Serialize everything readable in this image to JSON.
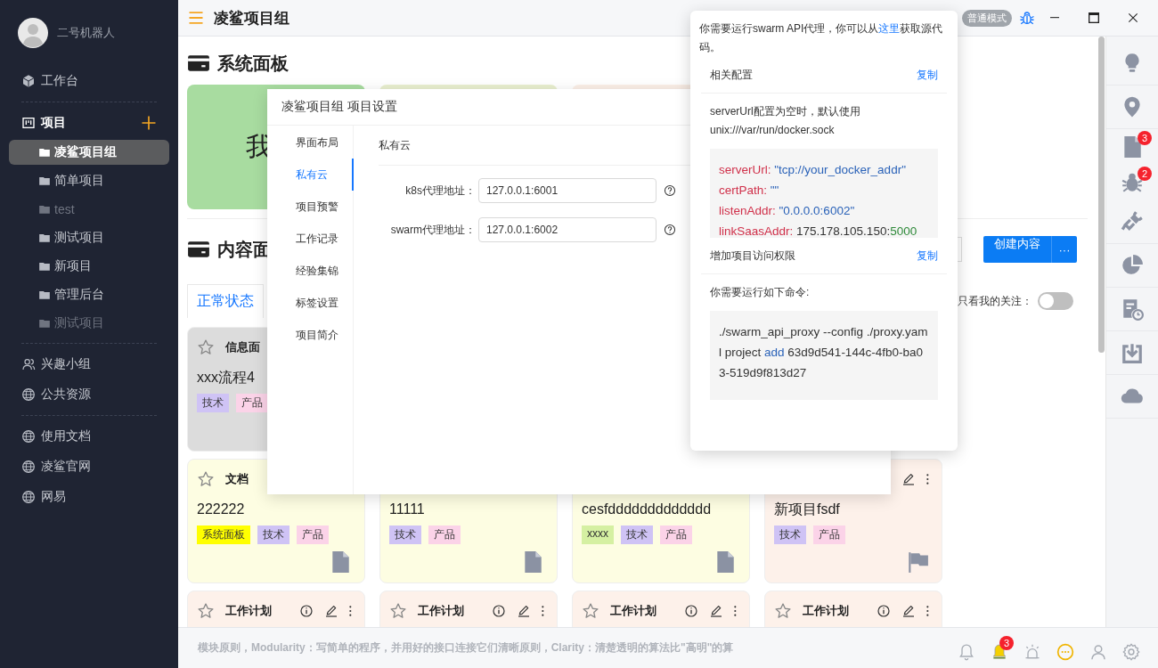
{
  "sidebar": {
    "user": {
      "name": "二号机器人"
    },
    "top_items": [
      {
        "label": "工作台",
        "kind": "cube"
      }
    ],
    "projects": {
      "label": "项目",
      "items": [
        {
          "label": "凌鲨项目组",
          "selected": true,
          "disabled": false
        },
        {
          "label": "简单项目",
          "selected": false,
          "disabled": false
        },
        {
          "label": "test",
          "selected": false,
          "disabled": true
        },
        {
          "label": "测试项目",
          "selected": false,
          "disabled": false
        },
        {
          "label": "新项目",
          "selected": false,
          "disabled": false
        },
        {
          "label": "管理后台",
          "selected": false,
          "disabled": false
        },
        {
          "label": "测试项目",
          "selected": false,
          "disabled": true
        }
      ]
    },
    "group_links": [
      {
        "label": "兴趣小组",
        "kind": "people"
      },
      {
        "label": "公共资源",
        "kind": "globe"
      }
    ],
    "external_links": [
      {
        "label": "使用文档",
        "kind": "globe"
      },
      {
        "label": "凌鲨官网",
        "kind": "globe"
      },
      {
        "label": "网易",
        "kind": "globe"
      }
    ]
  },
  "topbar": {
    "title": "凌鲨项目组",
    "mode": "普通模式"
  },
  "system_panel": {
    "title": "系统面板",
    "cards": [
      {
        "text": "我",
        "color": "#a8dca0"
      },
      {
        "color": "#e9efcf"
      },
      {
        "color": "#fbefe7"
      }
    ]
  },
  "content_panel": {
    "title": "内容面",
    "create_button": "创建内容",
    "more_button": "···",
    "tabs": [
      {
        "label": "正常状态",
        "selected": true
      }
    ],
    "filter": {
      "label": "只看我的关注：",
      "on": false
    },
    "card_rows": [
      [
        {
          "icons": [
            {
              "kind": "star"
            }
          ],
          "title": "信息面",
          "body": "xxx流程4",
          "color": "#dcdcdc",
          "kind": "panel",
          "tags": [
            {
              "label": "技术",
              "color": "#cfc3f5"
            },
            {
              "label": "产品",
              "color": "#fbd3e8"
            }
          ]
        }
      ],
      [
        {
          "icons": [
            {
              "kind": "star"
            }
          ],
          "title": "文档",
          "body": "222222",
          "color": "#fdfde2",
          "kind": "doc",
          "tags": [
            {
              "label": "系统面板",
              "color": "#ffff00"
            },
            {
              "label": "技术",
              "color": "#cfc3f5"
            },
            {
              "label": "产品",
              "color": "#fbd3e8"
            }
          ]
        },
        {
          "body": "11111",
          "color": "#fdfde2",
          "kind": "doc",
          "tags": [
            {
              "label": "技术",
              "color": "#cfc3f5"
            },
            {
              "label": "产品",
              "color": "#fbd3e8"
            }
          ]
        },
        {
          "body": "cesfddddddddddddd",
          "color": "#fdfde2",
          "kind": "doc",
          "tags": [
            {
              "label": "xxxx",
              "color": "#d5f0a2"
            },
            {
              "label": "技术",
              "color": "#cfc3f5"
            },
            {
              "label": "产品",
              "color": "#fbd3e8"
            }
          ]
        },
        {
          "icons": [
            {
              "kind": "edit"
            },
            {
              "kind": "more"
            }
          ],
          "body": "新项目fsdf",
          "color": "#fdf1ea",
          "kind": "flag",
          "tags": [
            {
              "label": "技术",
              "color": "#cfc3f5"
            },
            {
              "label": "产品",
              "color": "#fbd3e8"
            }
          ]
        }
      ],
      [
        {
          "icons": [
            {
              "kind": "star"
            },
            {
              "kind": "info"
            },
            {
              "kind": "edit"
            },
            {
              "kind": "more"
            }
          ],
          "title": "工作计划",
          "color": "#fdf1ea",
          "kind": "plan"
        },
        {
          "icons": [
            {
              "kind": "star"
            },
            {
              "kind": "info"
            },
            {
              "kind": "edit"
            },
            {
              "kind": "more"
            }
          ],
          "title": "工作计划",
          "color": "#fdf1ea",
          "kind": "plan"
        },
        {
          "icons": [
            {
              "kind": "star"
            },
            {
              "kind": "info"
            },
            {
              "kind": "edit"
            },
            {
              "kind": "more"
            }
          ],
          "title": "工作计划",
          "color": "#fdf1ea",
          "kind": "plan"
        },
        {
          "icons": [
            {
              "kind": "star"
            },
            {
              "kind": "info"
            },
            {
              "kind": "edit"
            },
            {
              "kind": "more"
            }
          ],
          "title": "工作计划",
          "color": "#fdf1ea",
          "kind": "plan"
        }
      ]
    ]
  },
  "dialog": {
    "title": "凌鲨项目组 项目设置",
    "menu": [
      {
        "label": "界面布局",
        "selected": false
      },
      {
        "label": "私有云",
        "selected": true
      },
      {
        "label": "项目预警",
        "selected": false
      },
      {
        "label": "工作记录",
        "selected": false
      },
      {
        "label": "经验集锦",
        "selected": false
      },
      {
        "label": "标签设置",
        "selected": false
      },
      {
        "label": "项目简介",
        "selected": false
      }
    ],
    "section_title": "私有云",
    "fields": [
      {
        "label": "k8s代理地址：",
        "value": "127.0.0.1:6001"
      },
      {
        "label": "swarm代理地址：",
        "value": "127.0.0.1:6002"
      }
    ]
  },
  "popover": {
    "intro": "你需要运行swarm API代理，你可以从",
    "intro_link": "这里",
    "intro_end": "获取源代码。",
    "sections": [
      {
        "title": "相关配置",
        "action": "复制",
        "note": "serverUrl配置为空时，默认使用unix:///var/run/docker.sock",
        "code": [
          [
            {
              "text": "serverUrl: ",
              "kind": "key"
            },
            {
              "text": "\"tcp://your_docker_addr\"",
              "kind": "string"
            }
          ],
          [
            {
              "text": "certPath: ",
              "kind": "key"
            },
            {
              "text": "\"\"",
              "kind": "string"
            }
          ],
          [
            {
              "text": "listenAddr: ",
              "kind": "key"
            },
            {
              "text": "\"0.0.0.0:6002\"",
              "kind": "string"
            }
          ],
          [
            {
              "text": "linkSaasAddr: ",
              "kind": "key"
            },
            {
              "text": "175.178.105.150:",
              "kind": "plain"
            },
            {
              "text": "5000",
              "kind": "number"
            }
          ]
        ]
      },
      {
        "title": "增加项目访问权限",
        "action": "复制",
        "note": "你需要运行如下命令:",
        "code": [
          [
            {
              "text": "./swarm_api_proxy --config ./proxy.yaml project ",
              "kind": "plain"
            },
            {
              "text": "add",
              "kind": "keyword"
            },
            {
              "text": " 63d9d541-144c-4fb0-ba03-519d9f813d27",
              "kind": "plain"
            }
          ]
        ]
      }
    ]
  },
  "right_toolbar": [
    {
      "kind": "bulb"
    },
    {
      "kind": "pin"
    },
    {
      "kind": "doc",
      "badge": "3"
    },
    {
      "kind": "bug",
      "badge": "2"
    },
    {
      "kind": "plug"
    },
    {
      "kind": "pie"
    },
    {
      "kind": "doc-clock"
    },
    {
      "kind": "download"
    },
    {
      "kind": "cloud"
    }
  ],
  "status_bar": {
    "text": "模块原则，Modularity：写简单的程序，并用好的接口连接它们清晰原则，Clarity：清楚透明的算法比\"高明\"的算",
    "icons": [
      {
        "kind": "bell"
      },
      {
        "kind": "bell-active",
        "badge": "3"
      },
      {
        "kind": "alarm"
      },
      {
        "kind": "chat"
      },
      {
        "kind": "user"
      },
      {
        "kind": "settings"
      }
    ]
  }
}
